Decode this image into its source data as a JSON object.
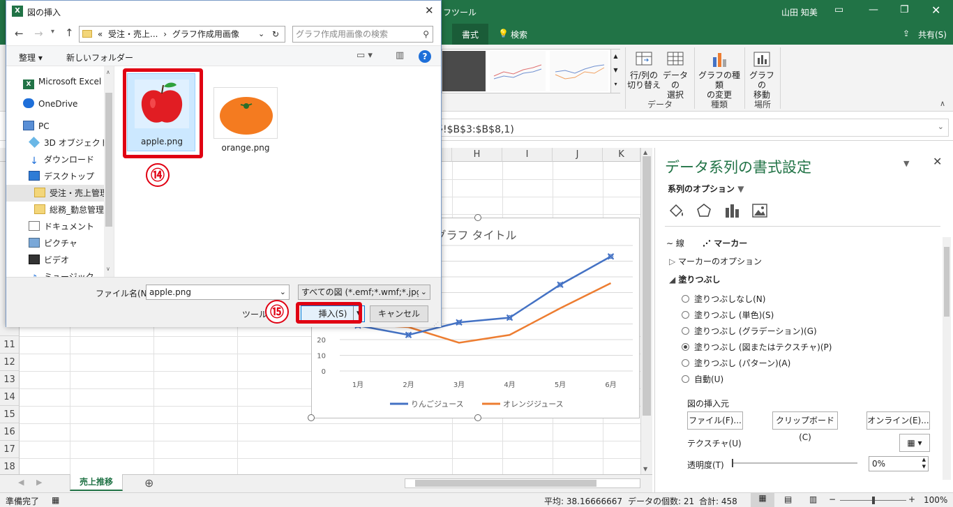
{
  "excel": {
    "tool_context": "フツール",
    "user": "山田 知美",
    "tabs": [
      "書式"
    ],
    "search_label": "検索",
    "share_label": "共有(S)",
    "ribbon": {
      "switch_row_col": [
        "行/列の",
        "切り替え"
      ],
      "select_data": [
        "データの",
        "選択"
      ],
      "change_type": [
        "グラフの種類",
        "の変更"
      ],
      "move_chart": [
        "グラフの",
        "移動"
      ],
      "groups": [
        "データ",
        "種類",
        "場所"
      ]
    },
    "formula_fragment": "移!$B$3:$B$8,1)",
    "columns": [
      "H",
      "I",
      "J",
      "K"
    ],
    "rows": [
      "11",
      "12",
      "13",
      "14",
      "15",
      "16",
      "17",
      "18"
    ],
    "sheet_tab": "売上推移",
    "status": {
      "ready": "準備完了",
      "average": "平均: 38.16666667",
      "count": "データの個数: 21",
      "sum": "合計: 458",
      "zoom": "100%"
    }
  },
  "chart": {
    "title": "グラフ タイトル",
    "y_ticks": [
      "0",
      "10",
      "20"
    ]
  },
  "chart_data": {
    "type": "line",
    "title": "グラフ タイトル",
    "categories": [
      "1月",
      "2月",
      "3月",
      "4月",
      "5月",
      "6月"
    ],
    "series": [
      {
        "name": "りんごジュース",
        "color": "#4472c4",
        "values": [
          29,
          23,
          31,
          34,
          55,
          73
        ]
      },
      {
        "name": "オレンジジュース",
        "color": "#ed7d31",
        "values": [
          30,
          28,
          18,
          23,
          40,
          56
        ]
      }
    ],
    "ylim": [
      0,
      80
    ],
    "legend": "bottom"
  },
  "pane": {
    "title": "データ系列の書式設定",
    "options_label": "系列のオプション",
    "line_tab": "線",
    "marker_tab": "マーカー",
    "marker_options": "マーカーのオプション",
    "fill": "塗りつぶし",
    "fill_options": [
      {
        "label": "塗りつぶしなし(N)",
        "checked": false
      },
      {
        "label": "塗りつぶし (単色)(S)",
        "checked": false
      },
      {
        "label": "塗りつぶし (グラデーション)(G)",
        "checked": false
      },
      {
        "label": "塗りつぶし (図またはテクスチャ)(P)",
        "checked": true
      },
      {
        "label": "塗りつぶし (パターン)(A)",
        "checked": false
      },
      {
        "label": "自動(U)",
        "checked": false
      }
    ],
    "insert_from": "図の挿入元",
    "file_btn": "ファイル(F)...",
    "clipboard_btn": "クリップボード(C)",
    "online_btn": "オンライン(E)...",
    "texture": "テクスチャ(U)",
    "transparency": "透明度(T)",
    "transparency_value": "0%"
  },
  "dialog": {
    "title": "図の挿入",
    "path": [
      "«",
      "受注・売上...",
      "›",
      "グラフ作成用画像"
    ],
    "search_placeholder": "グラフ作成用画像の検索",
    "organize": "整理 ▾",
    "new_folder": "新しいフォルダー",
    "tree": [
      {
        "label": "Microsoft Excel",
        "icon": "excel-icon"
      },
      {
        "label": "OneDrive",
        "icon": "cloud-icon"
      },
      {
        "label": "PC",
        "icon": "pc-icon"
      },
      {
        "label": "3D オブジェクト",
        "icon": "cube-icon"
      },
      {
        "label": "ダウンロード",
        "icon": "download-icon"
      },
      {
        "label": "デスクトップ",
        "icon": "desktop-icon"
      },
      {
        "label": "受注・売上管理",
        "icon": "folder-icon",
        "selected": true
      },
      {
        "label": "総務_勤怠管理",
        "icon": "folder-icon"
      },
      {
        "label": "ドキュメント",
        "icon": "document-icon"
      },
      {
        "label": "ピクチャ",
        "icon": "picture-icon"
      },
      {
        "label": "ビデオ",
        "icon": "video-icon"
      },
      {
        "label": "ミュージック",
        "icon": "music-icon"
      }
    ],
    "files": [
      "apple.png",
      "orange.png"
    ],
    "filename_label": "ファイル名(N):",
    "filename_value": "apple.png",
    "filetype_value": "すべての図 (*.emf;*.wmf;*.jpg;*.jp",
    "tools_label": "ツール(",
    "insert_btn": "挿入(S)",
    "cancel_btn": "キャンセル",
    "step14": "⑭",
    "step15": "⑮"
  }
}
